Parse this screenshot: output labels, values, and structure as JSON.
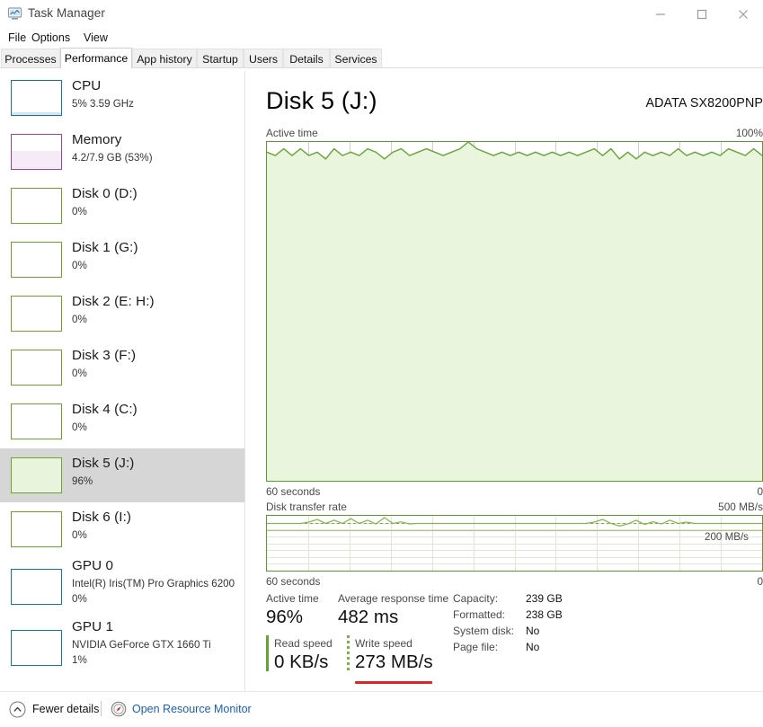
{
  "window": {
    "title": "Task Manager",
    "icon": "task-manager-icon",
    "minimize_label": "–",
    "maximize_label": "□",
    "close_label": "✕"
  },
  "menu": {
    "items": [
      "File",
      "Options",
      "View"
    ]
  },
  "tabs": {
    "active": "Performance",
    "items": [
      "Processes",
      "Performance",
      "App history",
      "Startup",
      "Users",
      "Details",
      "Services"
    ]
  },
  "sidebar": {
    "items": [
      {
        "name": "CPU",
        "sub": "5%  3.59 GHz",
        "sub2": "",
        "kind": "cpu",
        "fill": 8,
        "selected": false,
        "lines": 2
      },
      {
        "name": "Memory",
        "sub": "4.2/7.9 GB (53%)",
        "sub2": "",
        "kind": "mem",
        "fill": 53,
        "selected": false,
        "lines": 2
      },
      {
        "name": "Disk 0 (D:)",
        "sub": "0%",
        "sub2": "",
        "kind": "disk",
        "fill": 0,
        "selected": false,
        "lines": 2
      },
      {
        "name": "Disk 1 (G:)",
        "sub": "0%",
        "sub2": "",
        "kind": "disk",
        "fill": 0,
        "selected": false,
        "lines": 2
      },
      {
        "name": "Disk 2 (E: H:)",
        "sub": "0%",
        "sub2": "",
        "kind": "disk",
        "fill": 0,
        "selected": false,
        "lines": 2
      },
      {
        "name": "Disk 3 (F:)",
        "sub": "0%",
        "sub2": "",
        "kind": "disk",
        "fill": 0,
        "selected": false,
        "lines": 2
      },
      {
        "name": "Disk 4 (C:)",
        "sub": "0%",
        "sub2": "",
        "kind": "disk",
        "fill": 0,
        "selected": false,
        "lines": 2
      },
      {
        "name": "Disk 5 (J:)",
        "sub": "96%",
        "sub2": "",
        "kind": "disk",
        "fill": 100,
        "selected": true,
        "lines": 2
      },
      {
        "name": "Disk 6 (I:)",
        "sub": "0%",
        "sub2": "",
        "kind": "disk",
        "fill": 0,
        "selected": false,
        "lines": 2
      },
      {
        "name": "GPU 0",
        "sub": "Intel(R) Iris(TM) Pro Graphics 6200",
        "sub2": "0%",
        "kind": "gpu",
        "fill": 0,
        "selected": false,
        "lines": 3
      },
      {
        "name": "GPU 1",
        "sub": "NVIDIA GeForce GTX 1660 Ti",
        "sub2": "1%",
        "kind": "gpu",
        "fill": 1,
        "selected": false,
        "lines": 3
      }
    ]
  },
  "main": {
    "title": "Disk 5 (J:)",
    "model": "ADATA SX8200PNP",
    "active_graph": {
      "label": "Active time",
      "max_label": "100%",
      "x_label": "60 seconds",
      "min_label": "0"
    },
    "transfer_graph": {
      "label": "Disk transfer rate",
      "max_label": "500 MB/s",
      "x_label": "60 seconds",
      "min_label": "0",
      "reference_label": "200 MB/s"
    },
    "stats": {
      "active_time_label": "Active time",
      "active_time_value": "96%",
      "response_label": "Average response time",
      "response_value": "482 ms",
      "read_label": "Read speed",
      "read_value": "0 KB/s",
      "write_label": "Write speed",
      "write_value": "273 MB/s"
    },
    "info": [
      {
        "key": "Capacity:",
        "value": "239 GB"
      },
      {
        "key": "Formatted:",
        "value": "238 GB"
      },
      {
        "key": "System disk:",
        "value": "No"
      },
      {
        "key": "Page file:",
        "value": "No"
      }
    ]
  },
  "footer": {
    "fewer_details": "Fewer details",
    "resource_monitor": "Open Resource Monitor"
  },
  "colors": {
    "disk_accent": "#5d9732",
    "graph_fill": "#e9f5dc",
    "cpu_accent": "#1276a8",
    "memory_accent": "#9b45a0",
    "selection": "#d6d6d6",
    "link": "#1a5fb4",
    "annotation_red": "#e02222"
  },
  "chart_data": [
    {
      "type": "area",
      "title": "Active time",
      "ylabel": "",
      "xlabel": "60 seconds",
      "ylim": [
        0,
        100
      ],
      "y_max_label": "100%",
      "y_min_label": "0",
      "grid": true,
      "series": [
        {
          "name": "Active time",
          "values": [
            97,
            96,
            98,
            96,
            98,
            96,
            97,
            95,
            98,
            96,
            97,
            96,
            98,
            97,
            95,
            97,
            98,
            96,
            97,
            98,
            97,
            96,
            97,
            98,
            100,
            98,
            97,
            96,
            97,
            96,
            97,
            96,
            97,
            96,
            97,
            96,
            97,
            96,
            97,
            98,
            96,
            98,
            95,
            97,
            95,
            97,
            96,
            97,
            96,
            98,
            96,
            97,
            96,
            97,
            96,
            98,
            97,
            96,
            98,
            96
          ]
        }
      ]
    },
    {
      "type": "line",
      "title": "Disk transfer rate",
      "ylabel": "",
      "xlabel": "60 seconds",
      "ylim": [
        0,
        500
      ],
      "y_max_label": "500 MB/s",
      "y_min_label": "0",
      "reference_line": 200,
      "reference_label": "200 MB/s",
      "grid": true,
      "series": [
        {
          "name": "Transfer rate",
          "values": [
            200,
            200,
            200,
            200,
            200,
            205,
            215,
            200,
            212,
            200,
            218,
            200,
            212,
            198,
            222,
            200,
            206,
            198,
            200,
            200,
            200,
            200,
            200,
            200,
            200,
            200,
            200,
            200,
            200,
            200,
            200,
            200,
            200,
            200,
            200,
            200,
            200,
            200,
            200,
            205,
            215,
            200,
            190,
            198,
            212,
            196,
            206,
            198,
            212,
            200,
            205,
            200,
            200,
            200,
            200,
            200,
            200,
            200,
            200,
            200
          ]
        }
      ]
    }
  ]
}
